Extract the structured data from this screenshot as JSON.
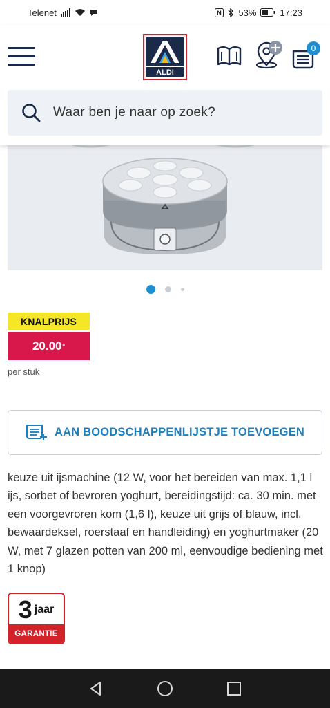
{
  "status_bar": {
    "carrier": "Telenet",
    "battery": "53%",
    "time": "17:23"
  },
  "header": {
    "logo_text": "ALDI",
    "icons": [
      "menu-icon",
      "folder-book-icon",
      "store-locator-add-icon",
      "shopping-list-icon"
    ],
    "cart_count": "0"
  },
  "search": {
    "placeholder": "Waar ben je naar op zoek?"
  },
  "carousel": {
    "current_index": 0,
    "total": 3
  },
  "price": {
    "label": "KNALPRIJS",
    "value": "20.00",
    "suffix": "*",
    "unit": "per stuk"
  },
  "actions": {
    "add_to_list": "AAN BOODSCHAPPENLIJSTJE TOEVOEGEN"
  },
  "description": "keuze uit ijsmachine (12 W, voor het bereiden van max. 1,1 l ijs, sorbet of bevroren yoghurt, bereidingstijd: ca. 30 min. met een voorgevroren kom (1,6 l), keuze uit grijs of blauw, incl. bewaardeksel, roerstaaf en handleiding) en yoghurtmaker (20 W, met 7 glazen potten van 200 ml, eenvoudige bediening met 1 knop)",
  "guarantee": {
    "number": "3",
    "unit": "jaar",
    "label": "GARANTIE"
  },
  "colors": {
    "aldi_blue": "#1c2a4a",
    "accent_blue": "#1e7fbf",
    "price_yellow": "#f5e727",
    "price_red": "#d8184b",
    "aldi_red": "#d2232a"
  }
}
